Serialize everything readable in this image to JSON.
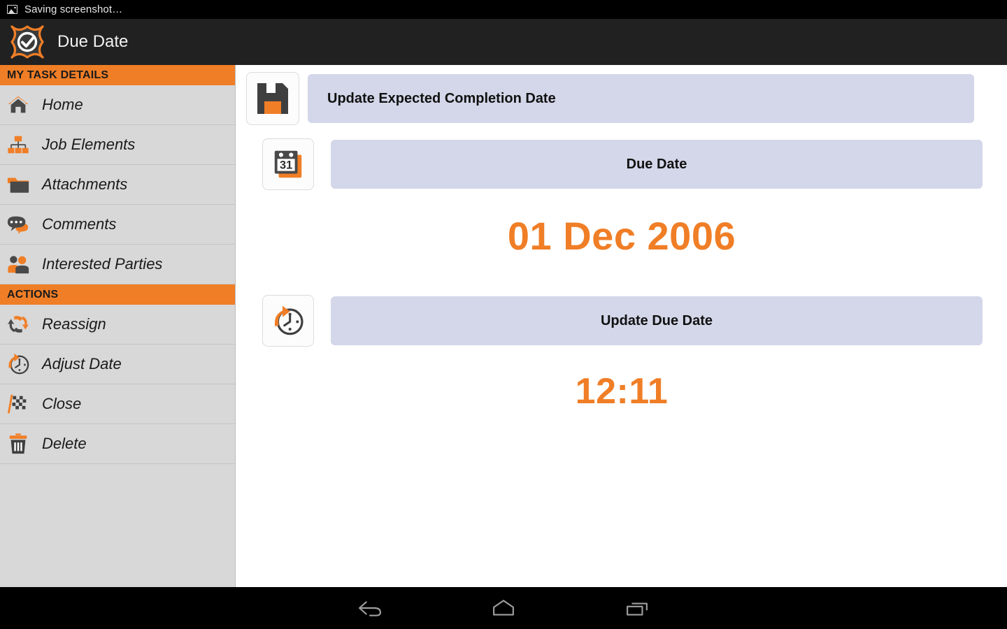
{
  "status_bar": {
    "icon": "image-icon",
    "text": "Saving screenshot…"
  },
  "app_bar": {
    "logo": "app-logo-check-star",
    "title": "Due Date"
  },
  "sidebar": {
    "sections": [
      {
        "header": "MY TASK DETAILS",
        "items": [
          {
            "label": "Home",
            "icon": "home-icon"
          },
          {
            "label": "Job Elements",
            "icon": "hierarchy-icon"
          },
          {
            "label": "Attachments",
            "icon": "folder-icon"
          },
          {
            "label": "Comments",
            "icon": "speech-bubble-icon"
          },
          {
            "label": "Interested Parties",
            "icon": "people-icon"
          }
        ]
      },
      {
        "header": "ACTIONS",
        "items": [
          {
            "label": "Reassign",
            "icon": "reassign-arrows-icon"
          },
          {
            "label": "Adjust Date",
            "icon": "clock-arrow-icon"
          },
          {
            "label": "Close",
            "icon": "checkered-flag-icon"
          },
          {
            "label": "Delete",
            "icon": "trash-icon"
          }
        ]
      }
    ]
  },
  "main": {
    "save_row": {
      "icon": "floppy-save-icon",
      "label": "Update Expected Completion Date"
    },
    "due_date_row": {
      "icon": "calendar-31-icon",
      "label": "Due Date"
    },
    "due_date_value": "01 Dec 2006",
    "update_due_date_row": {
      "icon": "clock-arrow-icon",
      "label": "Update Due Date"
    },
    "time_value": "12:11"
  },
  "nav_bar": {
    "back": "back-icon",
    "home": "home-icon",
    "recents": "recents-icon"
  },
  "colors": {
    "accent_orange": "#f07e26",
    "bar_lavender": "#d3d7e9",
    "sidebar_gray": "#d8d8d8",
    "app_bar_dark": "#212121",
    "icon_dark": "#3f3f3f"
  }
}
